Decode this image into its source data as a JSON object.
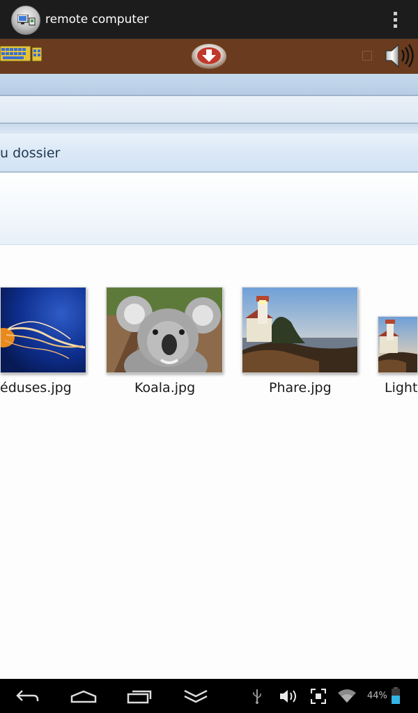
{
  "action_bar": {
    "title": "remote computer",
    "app_icon": "remote-desktop-app-icon",
    "overflow_icon": "overflow-menu-icon"
  },
  "remote_toolbar": {
    "background": "#6a3b1e",
    "icons": [
      "keyboard-icon",
      "download-arrow-icon",
      "checkbox-icon",
      "speaker-sound-icon"
    ]
  },
  "explorer": {
    "folder_label": "u dossier",
    "files": [
      {
        "name": "éduses.jpg",
        "image": "jellyfish-thumbnail"
      },
      {
        "name": "Koala.jpg",
        "image": "koala-thumbnail"
      },
      {
        "name": "Phare.jpg",
        "image": "lighthouse-thumbnail"
      },
      {
        "name": "Light",
        "image": "lighthouse-thumbnail-partial"
      }
    ]
  },
  "nav_bar": {
    "icons": [
      "back-icon",
      "home-icon",
      "recent-apps-icon",
      "collapse-icon",
      "usb-icon",
      "volume-icon",
      "screenshot-icon",
      "wifi-icon",
      "battery-icon"
    ],
    "battery_text": "44%",
    "battery_color": "#33b5e5"
  }
}
